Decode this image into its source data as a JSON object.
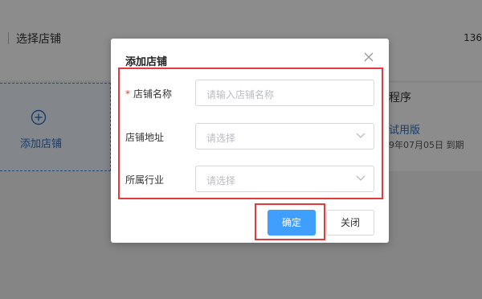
{
  "background": {
    "page_title": "选择店铺",
    "phone_partial": "136",
    "add_card_label": "添加店铺",
    "right_card": {
      "title": "程序",
      "trial_text": "试用版",
      "expire_text": "9年07月05日 到期"
    }
  },
  "dialog": {
    "title": "添加店铺",
    "fields": [
      {
        "label": "店铺名称",
        "required": "*",
        "placeholder": "请输入店铺名称",
        "type": "text"
      },
      {
        "label": "店铺地址",
        "placeholder": "请选择",
        "type": "select"
      },
      {
        "label": "所属行业",
        "placeholder": "请选择",
        "type": "select"
      }
    ],
    "confirm_label": "确定",
    "close_label": "关闭"
  },
  "colors": {
    "primary": "#409eff",
    "highlight": "#e23b3b",
    "link": "#2f6fc0"
  },
  "icons": [
    "close-icon",
    "plus-circle-icon",
    "chevron-down-icon"
  ]
}
